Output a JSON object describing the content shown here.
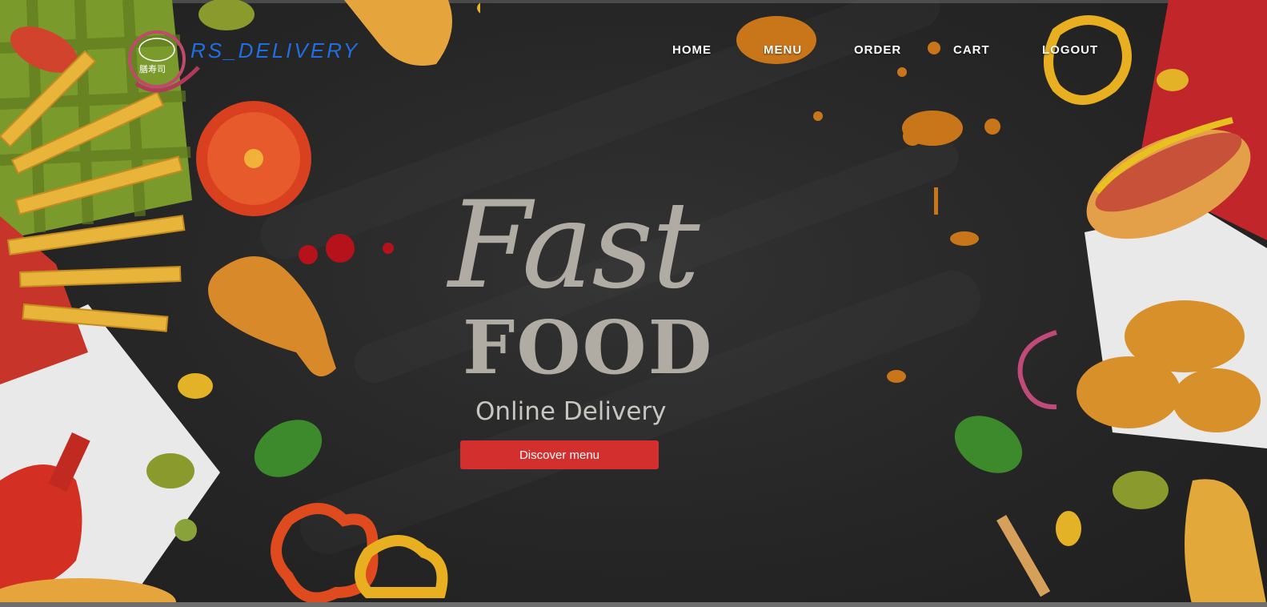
{
  "brand": {
    "name": "RS_DELIVERY",
    "logo_text": "膳寿司"
  },
  "nav": {
    "items": [
      {
        "label": "HOME"
      },
      {
        "label": "MENU"
      },
      {
        "label": "ORDER"
      },
      {
        "label": "CART"
      },
      {
        "label": "LOGOUT"
      }
    ]
  },
  "hero": {
    "title_script": "Fast",
    "title_bold": "FOOD",
    "subtitle": "Online Delivery",
    "cta_label": "Discover menu"
  },
  "colors": {
    "background": "#262626",
    "brand_text": "#1f6fe0",
    "title_text": "#b0aca4",
    "cta_bg": "#d32f2f"
  }
}
